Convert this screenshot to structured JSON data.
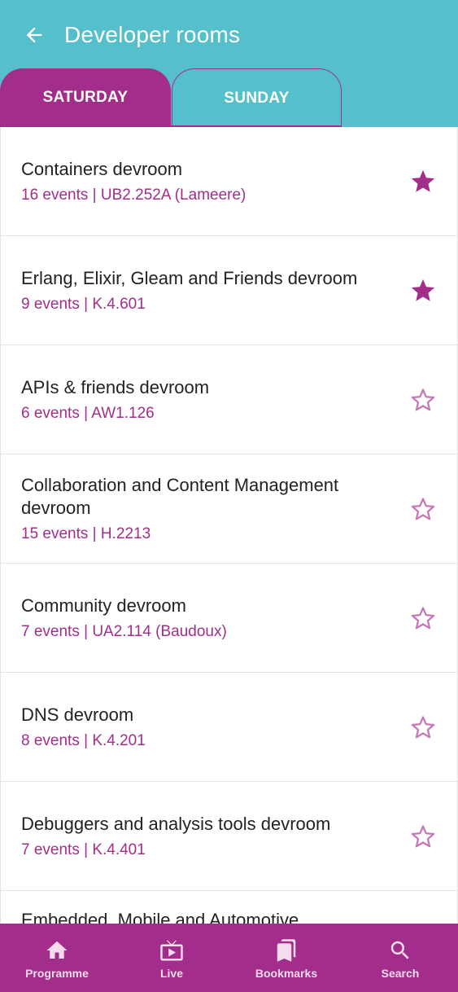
{
  "header": {
    "title": "Developer rooms",
    "back_icon": "arrow-left-icon"
  },
  "tabs": [
    {
      "label": "SATURDAY",
      "selected": true
    },
    {
      "label": "SUNDAY",
      "selected": false
    }
  ],
  "rooms": [
    {
      "title": "Containers devroom",
      "subtitle": "16 events | UB2.252A (Lameere)",
      "starred": true
    },
    {
      "title": "Erlang, Elixir, Gleam and Friends devroom",
      "subtitle": "9 events | K.4.601",
      "starred": true
    },
    {
      "title": "APIs & friends devroom",
      "subtitle": "6 events | AW1.126",
      "starred": false
    },
    {
      "title": "Collaboration and Content Management devroom",
      "subtitle": "15 events | H.2213",
      "starred": false
    },
    {
      "title": "Community devroom",
      "subtitle": "7 events | UA2.114 (Baudoux)",
      "starred": false
    },
    {
      "title": "DNS devroom",
      "subtitle": "8 events | K.4.201",
      "starred": false
    },
    {
      "title": "Debuggers and analysis tools devroom",
      "subtitle": "7 events | K.4.401",
      "starred": false
    },
    {
      "title": "Embedded, Mobile and Automotive",
      "subtitle": "",
      "starred": false
    }
  ],
  "bottom_nav": [
    {
      "label": "Programme",
      "icon": "home-icon"
    },
    {
      "label": "Live",
      "icon": "tv-icon"
    },
    {
      "label": "Bookmarks",
      "icon": "bookmarks-icon"
    },
    {
      "label": "Search",
      "icon": "search-icon"
    }
  ],
  "colors": {
    "header": "#56bfcc",
    "accent": "#a22d8a",
    "star_outline": "#c678b6"
  }
}
